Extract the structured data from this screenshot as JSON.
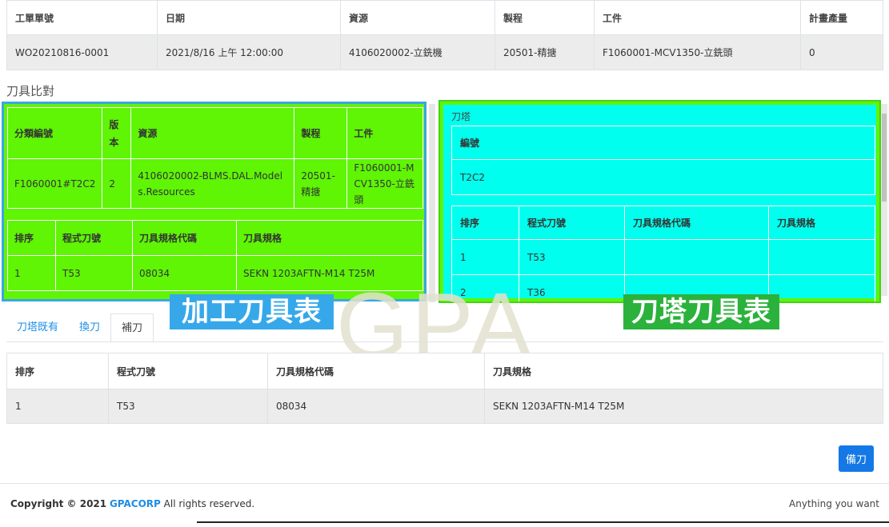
{
  "work_order": {
    "headers": [
      "工單單號",
      "日期",
      "資源",
      "製程",
      "工件",
      "計畫產量"
    ],
    "row": [
      "WO20210816-0001",
      "2021/8/16 上午 12:00:00",
      "4106020002-立銑機",
      "20501-精搪",
      "F1060001-MCV1350-立銑頭",
      "0"
    ]
  },
  "section_title": "刀具比對",
  "machining": {
    "cat_headers": [
      "分類編號",
      "版本",
      "資源",
      "製程",
      "工件"
    ],
    "cat_row": [
      "F1060001#T2C2",
      "2",
      "4106020002-BLMS.DAL.Models.Resources",
      "20501-精搪",
      "F1060001-MCV1350-立銑頭"
    ],
    "tool_headers": [
      "排序",
      "程式刀號",
      "刀具規格代碼",
      "刀具規格"
    ],
    "tool_rows": [
      [
        "1",
        "T53",
        "08034",
        "SEKN 1203AFTN-M14 T25M"
      ]
    ]
  },
  "turret": {
    "legend": "刀塔",
    "code_header": "編號",
    "code_value": "T2C2",
    "headers": [
      "排序",
      "程式刀號",
      "刀具規格代碼",
      "刀具規格"
    ],
    "rows": [
      [
        "1",
        "T53",
        "",
        ""
      ],
      [
        "2",
        "T36",
        "",
        ""
      ]
    ]
  },
  "overlay": {
    "machining_label": "加工刀具表",
    "turret_label": "刀塔刀具表",
    "watermark": "GPA"
  },
  "tabs": [
    "刀塔既有",
    "換刀",
    "補刀"
  ],
  "active_tab": 2,
  "replace_table": {
    "headers": [
      "排序",
      "程式刀號",
      "刀具規格代碼",
      "刀具規格"
    ],
    "rows": [
      [
        "1",
        "T53",
        "08034",
        "SEKN 1203AFTN-M14 T25M"
      ]
    ]
  },
  "prep_button": "備刀",
  "footer": {
    "copyright": "Copyright © 2021",
    "brand": "GPACORP",
    "rights": "All rights reserved.",
    "right_text": "Anything you want"
  },
  "colors": {
    "machining_bg": "#5ff505",
    "turret_bg": "#00ffee",
    "machining_label": "#36a8ea",
    "turret_label": "#2bb23c",
    "primary": "#1479e6"
  }
}
